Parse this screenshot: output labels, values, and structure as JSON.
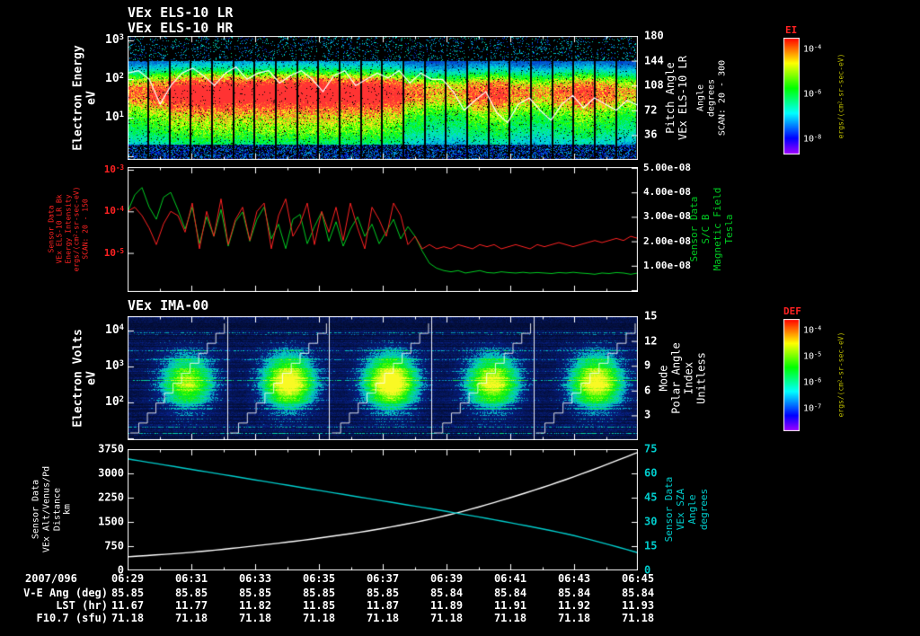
{
  "colors": {
    "background": "#000000",
    "white": "#ffffff",
    "red": "#ff2222",
    "green": "#00cc22",
    "cyan": "#00cccc",
    "yellow": "#bbbb00"
  },
  "panels": {
    "els": {
      "titles": [
        "VEx ELS-10 LR",
        "VEx ELS-10 HR"
      ],
      "ylabel_lines": [
        "Electron Energy",
        "eV"
      ],
      "yticks": [
        "10^3",
        "10^2",
        "10^1"
      ],
      "right_ticks": [
        "180",
        "144",
        "108",
        "72",
        "36"
      ],
      "right_label_main": [
        "Pitch Angle",
        "VEx ELS-10 LR"
      ],
      "right_label_sub": [
        "Angle",
        "degrees",
        "SCAN: 20 - 300"
      ],
      "colorbar": {
        "title": "EI",
        "ticks": [
          "10^-4",
          "10^-6",
          "10^-8"
        ],
        "units": "ergs/(cm^2-sr-sec-eV)"
      }
    },
    "els_line": {
      "yticks": [
        "10^-3",
        "10^-4",
        "10^-5"
      ],
      "ylabel_lines": [
        "Sensor Data",
        "VEx ELS-10 LR Bk",
        "Energy Intensity",
        "ergs/(cm^2-sr-sec-eV)",
        "SCAN: 20 - 150"
      ],
      "right_ticks": [
        "5.00e-08",
        "4.00e-08",
        "3.00e-08",
        "2.00e-08",
        "1.00e-08"
      ],
      "right_label": [
        "Sensor Data",
        "S/C B",
        "Magnetic Field",
        "Tesla"
      ]
    },
    "ima": {
      "title": "VEx IMA-00",
      "ylabel_lines": [
        "Electron Volts",
        "eV"
      ],
      "yticks": [
        "10^4",
        "10^3",
        "10^2"
      ],
      "right_ticks": [
        "15",
        "12",
        "9",
        "6",
        "3"
      ],
      "right_label": [
        "Mode",
        "Polar Angle",
        "Index",
        "Unitless"
      ],
      "colorbar": {
        "title": "DEF",
        "ticks": [
          "10^-4",
          "10^-5",
          "10^-6",
          "10^-7"
        ],
        "units": "ergs/(cm^2-sr-sec-eV)"
      }
    },
    "ephem_line": {
      "yticks": [
        "3750",
        "3000",
        "2250",
        "1500",
        "750",
        "0"
      ],
      "ylabel_lines": [
        "Sensor Data",
        "VEx Alt/Venus/Pd",
        "Distance",
        "km"
      ],
      "right_ticks": [
        "75",
        "60",
        "45",
        "30",
        "15",
        "0"
      ],
      "right_label": [
        "Sensor Data",
        "VEx SZA",
        "Angle",
        "degrees"
      ]
    }
  },
  "time_axis": {
    "date_label": "2007/096",
    "labels": [
      "06:29",
      "06:31",
      "06:33",
      "06:35",
      "06:37",
      "06:39",
      "06:41",
      "06:43",
      "06:45"
    ]
  },
  "ephemeris": {
    "rows": [
      {
        "label": "V-E Ang (deg)",
        "values": [
          "85.85",
          "85.85",
          "85.85",
          "85.85",
          "85.85",
          "85.84",
          "85.84",
          "85.84",
          "85.84"
        ]
      },
      {
        "label": "LST (hr)",
        "values": [
          "11.67",
          "11.77",
          "11.82",
          "11.85",
          "11.87",
          "11.89",
          "11.91",
          "11.92",
          "11.93"
        ]
      },
      {
        "label": "F10.7 (sfu)",
        "values": [
          "71.18",
          "71.18",
          "71.18",
          "71.18",
          "71.18",
          "71.18",
          "71.18",
          "71.18",
          "71.18"
        ]
      }
    ]
  },
  "chart_data": [
    {
      "id": "els_energy_spectrogram",
      "type": "heatmap",
      "title": "VEx ELS-10 LR / VEx ELS-10 HR",
      "x_axis": {
        "start": "06:29",
        "end": "06:45",
        "unit": "UT"
      },
      "y_axis": {
        "label": "Electron Energy (eV)",
        "scale": "log",
        "ticks": [
          10,
          100,
          1000
        ]
      },
      "z_axis": {
        "label": "EI ergs/(cm^2-sr-sec-eV)",
        "scale": "log",
        "ticks": [
          0.0001,
          1e-06,
          1e-08
        ]
      },
      "right_axis": {
        "label": "Pitch Angle (degrees)",
        "range": [
          0,
          180
        ],
        "ticks": [
          36,
          72,
          108,
          144,
          180
        ],
        "note": "SCAN: 20 - 300"
      },
      "n_sweeps": 24,
      "sweep_intensity_envelope": [
        0.7,
        0.8,
        0.95,
        1,
        1,
        0.95,
        1,
        1,
        1,
        1,
        0.95,
        1,
        0.9,
        0.7,
        0.6,
        0.6,
        0.75,
        0.8,
        0.65,
        0.6,
        0.7,
        0.8,
        0.7,
        0.6
      ],
      "overlay_trace_yfrac": [
        0.3,
        0.28,
        0.35,
        0.55,
        0.4,
        0.3,
        0.26,
        0.32,
        0.4,
        0.3,
        0.25,
        0.35,
        0.3,
        0.28,
        0.38,
        0.32,
        0.28,
        0.35,
        0.45,
        0.32,
        0.28,
        0.4,
        0.35,
        0.3,
        0.34,
        0.28,
        0.38,
        0.3,
        0.35,
        0.35,
        0.45,
        0.6,
        0.52,
        0.45,
        0.62,
        0.7,
        0.55,
        0.5,
        0.6,
        0.68,
        0.55,
        0.48,
        0.58,
        0.5,
        0.55,
        0.6,
        0.52,
        0.56
      ],
      "description": "Green spectrogram with intense red band near 30-100 eV strongest 06:31-06:38, blue speckle above 300 eV, black data gaps between sweeps, white trace overlay"
    },
    {
      "id": "els_intensity_and_b_field",
      "type": "line",
      "x_axis": {
        "start": "06:29",
        "end": "06:45",
        "n_points": 72
      },
      "series": [
        {
          "name": "ELS energy intensity",
          "color": "#ff2222",
          "axis": "left",
          "scale": "log",
          "units": "ergs/(cm^2-sr-sec-eV)",
          "ylim_log10": [
            -6,
            -3
          ],
          "values_log10": [
            -4.0,
            -3.9,
            -4.1,
            -4.4,
            -4.8,
            -4.3,
            -4.0,
            -4.1,
            -4.5,
            -3.8,
            -4.9,
            -4.0,
            -4.6,
            -3.7,
            -4.8,
            -4.2,
            -3.9,
            -4.7,
            -4.0,
            -3.8,
            -4.9,
            -4.1,
            -3.7,
            -4.6,
            -4.3,
            -3.8,
            -4.8,
            -4.0,
            -4.5,
            -3.9,
            -4.7,
            -3.8,
            -4.4,
            -4.9,
            -3.9,
            -4.2,
            -4.6,
            -3.8,
            -4.1,
            -4.8,
            -4.6,
            -4.9,
            -4.8,
            -4.9,
            -4.85,
            -4.9,
            -4.8,
            -4.85,
            -4.9,
            -4.8,
            -4.85,
            -4.8,
            -4.9,
            -4.85,
            -4.8,
            -4.85,
            -4.9,
            -4.8,
            -4.85,
            -4.8,
            -4.75,
            -4.8,
            -4.85,
            -4.8,
            -4.75,
            -4.7,
            -4.75,
            -4.7,
            -4.65,
            -4.7,
            -4.6,
            -4.65
          ]
        },
        {
          "name": "S/C B magnetic field",
          "color": "#00cc22",
          "axis": "right",
          "units": "Tesla",
          "ylim": [
            0,
            5e-08
          ],
          "values_1e8": [
            3.2,
            3.9,
            4.2,
            3.4,
            2.9,
            3.8,
            4.0,
            3.3,
            2.5,
            3.4,
            1.9,
            3.0,
            2.2,
            3.3,
            1.8,
            2.8,
            3.2,
            2.0,
            2.9,
            3.4,
            2.1,
            2.7,
            1.7,
            2.9,
            3.1,
            1.9,
            2.6,
            3.2,
            2.0,
            2.8,
            1.8,
            2.5,
            3.0,
            2.2,
            2.7,
            1.9,
            2.4,
            2.9,
            2.1,
            2.6,
            2.2,
            1.6,
            1.1,
            0.9,
            0.8,
            0.75,
            0.8,
            0.7,
            0.75,
            0.8,
            0.72,
            0.7,
            0.75,
            0.72,
            0.7,
            0.73,
            0.7,
            0.72,
            0.7,
            0.68,
            0.72,
            0.7,
            0.73,
            0.7,
            0.68,
            0.65,
            0.7,
            0.68,
            0.72,
            0.7,
            0.65,
            0.7
          ]
        }
      ]
    },
    {
      "id": "ima_spectrogram",
      "type": "heatmap",
      "title": "VEx IMA-00",
      "x_axis": {
        "start": "06:29",
        "end": "06:45",
        "unit": "UT"
      },
      "y_axis": {
        "label": "Electron Volts (eV)",
        "scale": "log",
        "ticks": [
          100,
          1000,
          10000
        ]
      },
      "z_axis": {
        "label": "DEF ergs/(cm^2-sr-sec-eV)",
        "scale": "log",
        "ticks": [
          0.0001,
          1e-05,
          1e-06,
          1e-07
        ]
      },
      "right_axis": {
        "label": "Mode / Polar Angle Index (Unitless)",
        "ticks": [
          3,
          6,
          9,
          12,
          15
        ]
      },
      "section_dividers_frac": [
        0.195,
        0.395,
        0.595,
        0.795
      ],
      "blob_centers_frac": [
        0.117,
        0.315,
        0.515,
        0.715,
        0.918
      ],
      "blob_amplitudes": [
        0.75,
        0.95,
        1.0,
        0.85,
        0.9
      ],
      "blob_yfrac": 0.53,
      "description": "Dark blue noisy spectrogram, bright cyan-green-yellow ion blobs at mid energies in each of 5 sections, white stepped sweep lines rising across each section"
    },
    {
      "id": "ephemeris_lines",
      "type": "line",
      "x_axis": {
        "start": "06:29",
        "end": "06:45",
        "n_points": 9
      },
      "series": [
        {
          "name": "VEx Alt/Venus/Pd Distance",
          "color": "#ffffff",
          "axis": "left",
          "units": "km",
          "ylim": [
            0,
            3750
          ],
          "values": [
            420,
            560,
            760,
            1000,
            1300,
            1700,
            2250,
            2900,
            3650
          ]
        },
        {
          "name": "VEx SZA",
          "color": "#00cccc",
          "axis": "right",
          "units": "degrees",
          "ylim": [
            0,
            75
          ],
          "values": [
            69,
            62.5,
            56,
            49.5,
            43,
            36.5,
            29.5,
            21.5,
            11
          ]
        }
      ]
    }
  ]
}
